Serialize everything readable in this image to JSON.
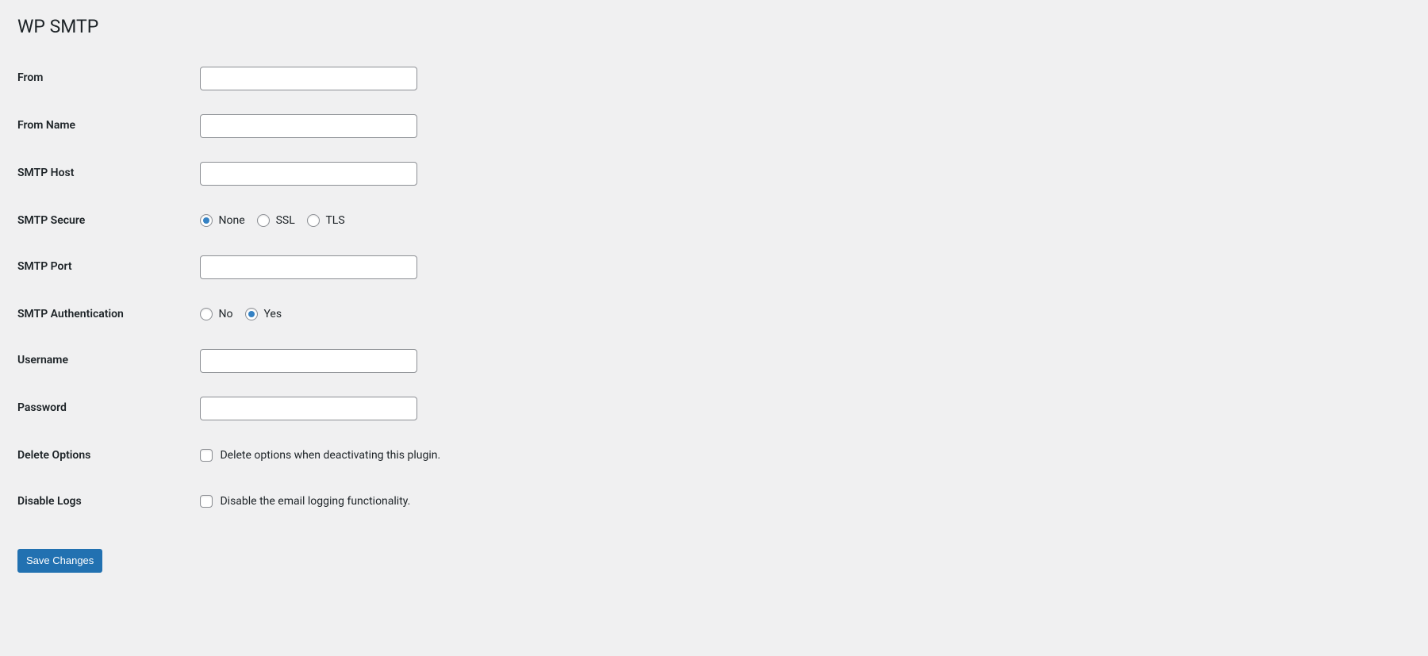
{
  "page": {
    "title": "WP SMTP"
  },
  "form": {
    "from": {
      "label": "From",
      "value": ""
    },
    "from_name": {
      "label": "From Name",
      "value": ""
    },
    "smtp_host": {
      "label": "SMTP Host",
      "value": ""
    },
    "smtp_secure": {
      "label": "SMTP Secure",
      "selected": "none",
      "options": {
        "none": "None",
        "ssl": "SSL",
        "tls": "TLS"
      }
    },
    "smtp_port": {
      "label": "SMTP Port",
      "value": ""
    },
    "smtp_auth": {
      "label": "SMTP Authentication",
      "selected": "yes",
      "options": {
        "no": "No",
        "yes": "Yes"
      }
    },
    "username": {
      "label": "Username",
      "value": ""
    },
    "password": {
      "label": "Password",
      "value": ""
    },
    "delete_options": {
      "label": "Delete Options",
      "checkbox_label": "Delete options when deactivating this plugin.",
      "checked": false
    },
    "disable_logs": {
      "label": "Disable Logs",
      "checkbox_label": "Disable the email logging functionality.",
      "checked": false
    },
    "submit_label": "Save Changes"
  }
}
